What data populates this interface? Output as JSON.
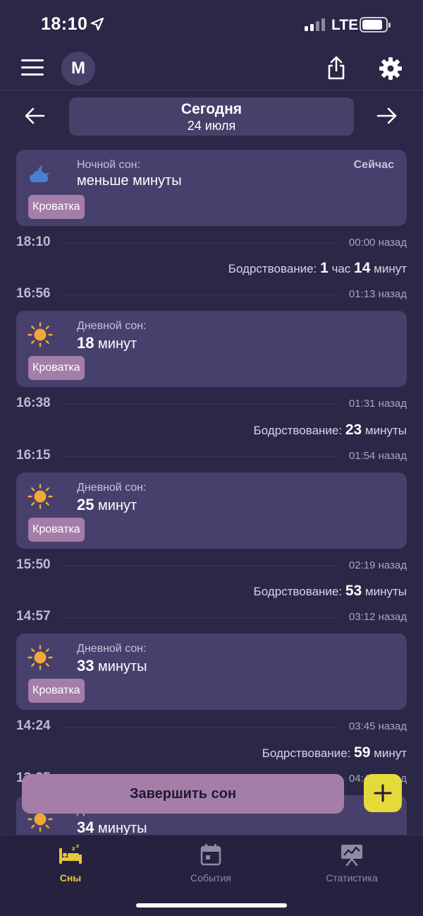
{
  "status_bar": {
    "time": "18:10",
    "network": "LTE"
  },
  "header": {
    "avatar_letter": "M"
  },
  "date_nav": {
    "title": "Сегодня",
    "subtitle": "24 июля"
  },
  "cards": [
    {
      "type": "night",
      "label": "Ночной сон:",
      "value": "меньше минуты",
      "tag": "Кроватка",
      "status": "Сейчас"
    },
    {
      "type": "day",
      "label": "Дневной сон:",
      "value_num": "18",
      "value_unit": "минут",
      "tag": "Кроватка"
    },
    {
      "type": "day",
      "label": "Дневной сон:",
      "value_num": "25",
      "value_unit": "минут",
      "tag": "Кроватка"
    },
    {
      "type": "day",
      "label": "Дневной сон:",
      "value_num": "33",
      "value_unit": "минуты",
      "tag": "Кроватка"
    },
    {
      "type": "day",
      "label": "Дневной сон:",
      "value_num": "34",
      "value_unit": "минуты"
    }
  ],
  "timeline": [
    {
      "time": "18:10",
      "ago": "00:00 назад"
    },
    {
      "time": "16:56",
      "ago": "01:13 назад"
    },
    {
      "time": "16:38",
      "ago": "01:31 назад"
    },
    {
      "time": "16:15",
      "ago": "01:54 назад"
    },
    {
      "time": "15:50",
      "ago": "02:19 назад"
    },
    {
      "time": "14:57",
      "ago": "03:12 назад"
    },
    {
      "time": "14:24",
      "ago": "03:45 назад"
    },
    {
      "time": "13:25",
      "ago": "04:44 назад"
    }
  ],
  "wake_periods": [
    {
      "label": "Бодрствование:",
      "n1": "1",
      "u1": "час",
      "n2": "14",
      "u2": "минут"
    },
    {
      "label": "Бодрствование:",
      "n1": "23",
      "u1": "минуты"
    },
    {
      "label": "Бодрствование:",
      "n1": "53",
      "u1": "минуты"
    },
    {
      "label": "Бодрствование:",
      "n1": "59",
      "u1": "минут"
    }
  ],
  "actions": {
    "end_sleep": "Завершить сон",
    "add": "+"
  },
  "tabs": [
    {
      "label": "Сны",
      "active": true
    },
    {
      "label": "События",
      "active": false
    },
    {
      "label": "Статистика",
      "active": false
    }
  ],
  "colors": {
    "background": "#2b2747",
    "card": "#47406c",
    "tag": "#a57da9",
    "accent_yellow": "#e6d93a",
    "sun": "#f0a83a",
    "moon_cloud": "#4a80d0"
  }
}
